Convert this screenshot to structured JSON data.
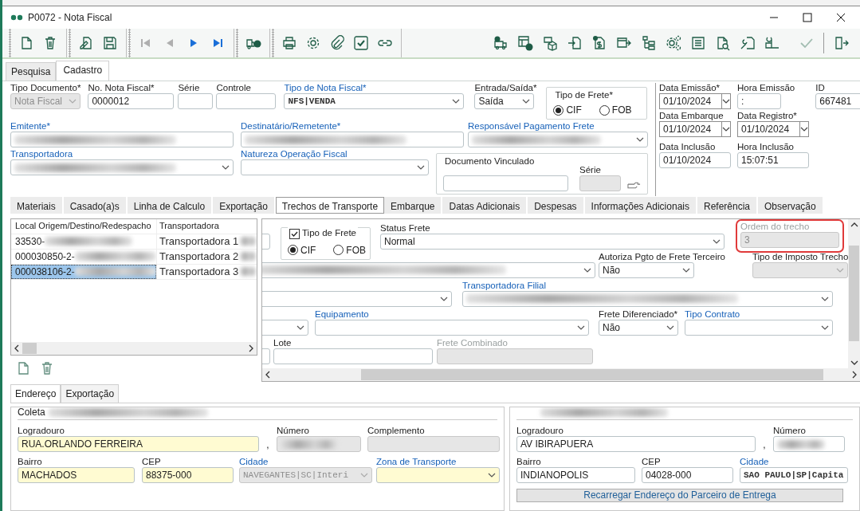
{
  "window": {
    "title": "P0072 - Nota Fiscal"
  },
  "toolbar": {
    "left_groups": [
      [
        {
          "disabled": false
        },
        {
          "disabled": false
        }
      ],
      [
        {
          "disabled": false
        },
        {
          "disabled": false
        }
      ],
      [
        {
          "disabled": true
        },
        {
          "disabled": true
        },
        {
          "disabled": false
        },
        {
          "disabled": false
        }
      ],
      [
        {
          "disabled": false
        }
      ],
      [
        {
          "disabled": false
        },
        {
          "disabled": false
        },
        {
          "disabled": false
        },
        {
          "disabled": false
        },
        {
          "disabled": false
        }
      ]
    ],
    "right": [
      {
        "disabled": false
      },
      {
        "disabled": false
      },
      {
        "disabled": false
      },
      {
        "disabled": false
      },
      {
        "disabled": false
      },
      {
        "disabled": false
      },
      {
        "disabled": false
      },
      {
        "disabled": false
      },
      {
        "disabled": false
      },
      {
        "disabled": false
      },
      {
        "disabled": false
      },
      {
        "disabled": false
      },
      {
        "disabled": true
      },
      {
        "disabled": false
      }
    ]
  },
  "top_tabs": [
    {
      "label": "Pesquisa",
      "selected": false
    },
    {
      "label": "Cadastro",
      "selected": true
    }
  ],
  "header": {
    "rows": [
      [
        {
          "label": "Tipo Documento*",
          "kind": "select",
          "value": "Nota Fiscal",
          "linked": false,
          "disabled": true,
          "blurred": false
        },
        {
          "label": "No. Nota Fiscal*",
          "kind": "text",
          "value": "0000012",
          "linked": false,
          "disabled": false,
          "blurred": false
        },
        {
          "label": "Série",
          "kind": "text",
          "linked": false,
          "disabled": false,
          "blurred": false
        },
        {
          "label": "Controle",
          "kind": "text",
          "linked": false,
          "disabled": false,
          "blurred": false
        },
        {
          "label": "Tipo de Nota Fiscal*",
          "kind": "code-select",
          "value": "NFS|VENDA",
          "linked": true,
          "disabled": false,
          "blurred": false
        },
        {
          "label": "Entrada/Saída*",
          "kind": "select",
          "value": "Saída",
          "linked": false,
          "disabled": false,
          "blurred": false
        },
        {
          "label": "Tipo de Frete*",
          "kind": "radio",
          "options": [
            {
              "label": "CIF",
              "selected": true
            },
            {
              "label": "FOB",
              "selected": false
            }
          ]
        }
      ],
      [
        {
          "label": "Emitente*",
          "kind": "text",
          "linked": true,
          "disabled": false,
          "blurred": true
        },
        {
          "label": "Destinatário/Remetente*",
          "kind": "text",
          "linked": true,
          "disabled": false,
          "blurred": true
        },
        {
          "label": "Responsável Pagamento Frete",
          "kind": "select",
          "linked": true,
          "disabled": false,
          "blurred": true
        }
      ],
      [
        {
          "label": "Transportadora",
          "kind": "select",
          "linked": true,
          "disabled": false,
          "blurred": true
        },
        {
          "label": "Natureza Operação Fiscal",
          "kind": "select",
          "linked": true,
          "disabled": false,
          "blurred": false
        },
        {
          "label": "Documento Vinculado",
          "kind": "group",
          "fields": [
            {
              "kind": "text",
              "disabled": false,
              "blurred": false
            },
            {
              "label": "Série",
              "kind": "text",
              "linked": false,
              "disabled": true,
              "blurred": false
            }
          ]
        }
      ]
    ],
    "dates": [
      [
        {
          "label": "Data Emissão*",
          "kind": "date",
          "value": "01/10/2024",
          "linked": false,
          "disabled": false,
          "blurred": false
        },
        {
          "label": "Hora Emissão",
          "kind": "text",
          "value": ":",
          "linked": false,
          "disabled": false,
          "blurred": false
        },
        {
          "label": "ID",
          "kind": "text",
          "value": "667481",
          "linked": false,
          "disabled": false,
          "blurred": false
        }
      ],
      [
        {
          "label": "Data Embarque",
          "kind": "date",
          "value": "01/10/2024",
          "linked": false,
          "disabled": false,
          "blurred": false
        },
        {
          "label": "Data Registro*",
          "kind": "date",
          "value": "01/10/2024",
          "linked": false,
          "disabled": false,
          "blurred": false
        }
      ],
      [
        {
          "label": "Data Inclusão",
          "kind": "text",
          "value": "01/10/2024",
          "linked": false,
          "disabled": false,
          "blurred": false
        },
        {
          "label": "Hora Inclusão",
          "kind": "text",
          "value": "15:07:51",
          "linked": false,
          "disabled": false,
          "blurred": false
        }
      ]
    ]
  },
  "detail_tabs": [
    {
      "label": "Materiais",
      "selected": false
    },
    {
      "label": "Casado(a)s",
      "selected": false
    },
    {
      "label": "Linha de Calculo",
      "selected": false
    },
    {
      "label": "Exportação",
      "selected": false
    },
    {
      "label": "Trechos de Transporte",
      "selected": true
    },
    {
      "label": "Embarque",
      "selected": false
    },
    {
      "label": "Datas Adicionais",
      "selected": false
    },
    {
      "label": "Despesas",
      "selected": false
    },
    {
      "label": "Informações Adicionais",
      "selected": false
    },
    {
      "label": "Referência",
      "selected": false
    },
    {
      "label": "Observação",
      "selected": false
    }
  ],
  "segments": {
    "list": {
      "columns": [
        "Local Origem/Destino/Redespacho",
        "Transportadora"
      ],
      "rows": [
        {
          "cells": [
            "33530-",
            "Transportadora 1"
          ],
          "selected": false
        },
        {
          "cells": [
            "000030850-2-",
            "Transportadora 2"
          ],
          "selected": false
        },
        {
          "cells": [
            "000038106-2-",
            "Transportadora 3"
          ],
          "selected": true
        }
      ]
    },
    "form": {
      "rows": [
        [
          {
            "kind": "text",
            "disabled": false,
            "blurred": false,
            "highlighted": false
          },
          {
            "label": "Tipo de Frete",
            "kind": "check-radio",
            "checked": true,
            "options": [
              {
                "label": "CIF",
                "selected": true
              },
              {
                "label": "FOB",
                "selected": false
              }
            ]
          },
          {
            "label": "Status Frete",
            "kind": "select",
            "value": "Normal",
            "linked": false,
            "disabled": false,
            "blurred": false,
            "highlighted": false
          },
          {
            "label": "Ordem do trecho",
            "kind": "text",
            "value": "3",
            "linked": false,
            "disabled": true,
            "blurred": false,
            "highlighted": true
          }
        ],
        [
          {
            "kind": "select",
            "disabled": false,
            "blurred": true,
            "highlighted": false
          },
          {
            "label": "Autoriza Pgto de Frete Terceiro",
            "kind": "select",
            "value": "Não",
            "linked": false,
            "disabled": false,
            "blurred": false,
            "highlighted": false
          },
          {
            "label": "Tipo de Imposto Trecho",
            "kind": "select",
            "linked": false,
            "disabled": true,
            "blurred": false,
            "highlighted": false
          }
        ],
        [
          {
            "kind": "select",
            "disabled": false,
            "blurred": false,
            "highlighted": false
          },
          {
            "label": "Transportadora Filial",
            "kind": "select",
            "linked": true,
            "disabled": false,
            "blurred": true,
            "highlighted": false
          }
        ],
        [
          {
            "kind": "select",
            "disabled": false,
            "blurred": false,
            "highlighted": false
          },
          {
            "label": "Equipamento",
            "kind": "select",
            "linked": true,
            "disabled": false,
            "blurred": false,
            "highlighted": false
          },
          {
            "label": "Frete Diferenciado*",
            "kind": "select",
            "value": "Não",
            "linked": false,
            "disabled": false,
            "blurred": false,
            "highlighted": false
          },
          {
            "label": "Tipo Contrato",
            "kind": "select",
            "linked": true,
            "disabled": false,
            "blurred": false,
            "highlighted": false
          }
        ],
        [
          {
            "kind": "text",
            "disabled": false,
            "blurred": false,
            "highlighted": false
          },
          {
            "label": "Lote",
            "kind": "text",
            "linked": false,
            "disabled": false,
            "blurred": false,
            "highlighted": false
          },
          {
            "label": "Frete Combinado",
            "kind": "text",
            "linked": false,
            "disabled": true,
            "blurred": false,
            "highlighted": false
          }
        ]
      ]
    }
  },
  "address_tabs": [
    {
      "label": "Endereço",
      "selected": true
    },
    {
      "label": "Exportação",
      "selected": false
    }
  ],
  "address": {
    "groups": [
      {
        "title": "Coleta",
        "fields": [
          {
            "label": "Logradouro",
            "kind": "text",
            "value": "RUA.ORLANDO FERREIRA",
            "suffix": ",",
            "linked": false,
            "disabled": false,
            "blurred": false,
            "required": true
          },
          {
            "label": "Número",
            "kind": "text",
            "linked": false,
            "disabled": true,
            "blurred": true,
            "required": false
          },
          {
            "label": "Complemento",
            "kind": "text",
            "linked": false,
            "disabled": true,
            "blurred": false,
            "required": false
          },
          {
            "label": "Bairro",
            "kind": "text",
            "value": "MACHADOS",
            "linked": false,
            "disabled": false,
            "blurred": false,
            "required": true
          },
          {
            "label": "CEP",
            "kind": "text",
            "value": "88375-000",
            "linked": false,
            "disabled": false,
            "blurred": false,
            "required": true
          },
          {
            "label": "Cidade",
            "kind": "code-select",
            "value": "NAVEGANTES|SC|Interi",
            "linked": true,
            "disabled": true,
            "blurred": false,
            "required": false
          },
          {
            "label": "Zona de Transporte",
            "kind": "select",
            "linked": true,
            "disabled": false,
            "blurred": false,
            "required": true
          }
        ]
      },
      {
        "fields": [
          {
            "label": "Logradouro",
            "kind": "text",
            "value": "AV IBIRAPUERA",
            "suffix": ",",
            "linked": false,
            "disabled": false,
            "blurred": false,
            "required": false
          },
          {
            "label": "Número",
            "kind": "text",
            "linked": false,
            "disabled": false,
            "blurred": true,
            "required": false
          },
          {
            "label": "Bairro",
            "kind": "text",
            "value": "INDIANOPOLIS",
            "linked": false,
            "disabled": false,
            "blurred": false,
            "required": false
          },
          {
            "label": "CEP",
            "kind": "text",
            "value": "04028-000",
            "linked": false,
            "disabled": false,
            "blurred": false,
            "required": false
          },
          {
            "label": "Cidade",
            "kind": "code-text",
            "value": "SAO PAULO|SP|Capita",
            "linked": true,
            "disabled": false,
            "blurred": false,
            "required": false
          }
        ],
        "button": "Recarregar Endereço do Parceiro de Entrega"
      }
    ]
  }
}
